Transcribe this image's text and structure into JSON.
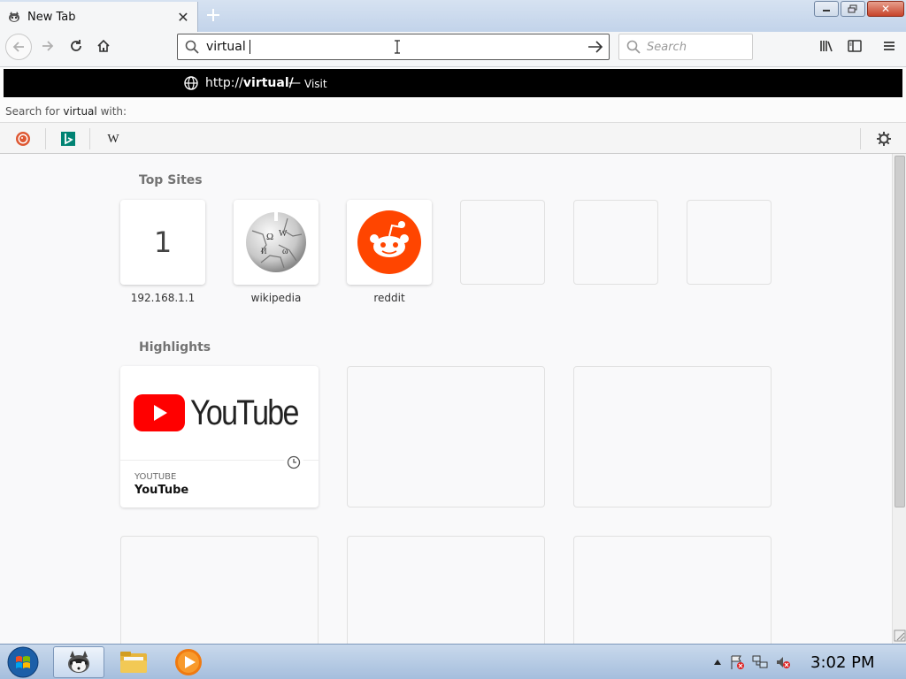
{
  "tab": {
    "title": "New Tab",
    "favicon": "raccoon-icon"
  },
  "toolbar": {
    "url_value": "virtual",
    "search_placeholder": "Search"
  },
  "suggestion": {
    "url_prefix": "http://",
    "url_bold": "virtual/",
    "separator": "—",
    "action": "Visit"
  },
  "search_with": {
    "prefix": "Search for",
    "term": "virtual",
    "suffix": "with:"
  },
  "engines": [
    "duckduckgo-icon",
    "bing-icon",
    "wikipedia-icon"
  ],
  "top_sites": {
    "title": "Top Sites",
    "items": [
      {
        "label": "192.168.1.1",
        "glyph": "1"
      },
      {
        "label": "wikipedia",
        "glyph": ""
      },
      {
        "label": "reddit",
        "glyph": ""
      }
    ]
  },
  "highlights": {
    "title": "Highlights",
    "items": [
      {
        "host": "YOUTUBE",
        "title": "YouTube",
        "logo_text": "YouTube"
      }
    ]
  },
  "taskbar": {
    "time": "3:02 PM"
  },
  "colors": {
    "reddit": "#ff4500",
    "youtube": "#ff0000",
    "url_border": "#5a5a5a"
  }
}
